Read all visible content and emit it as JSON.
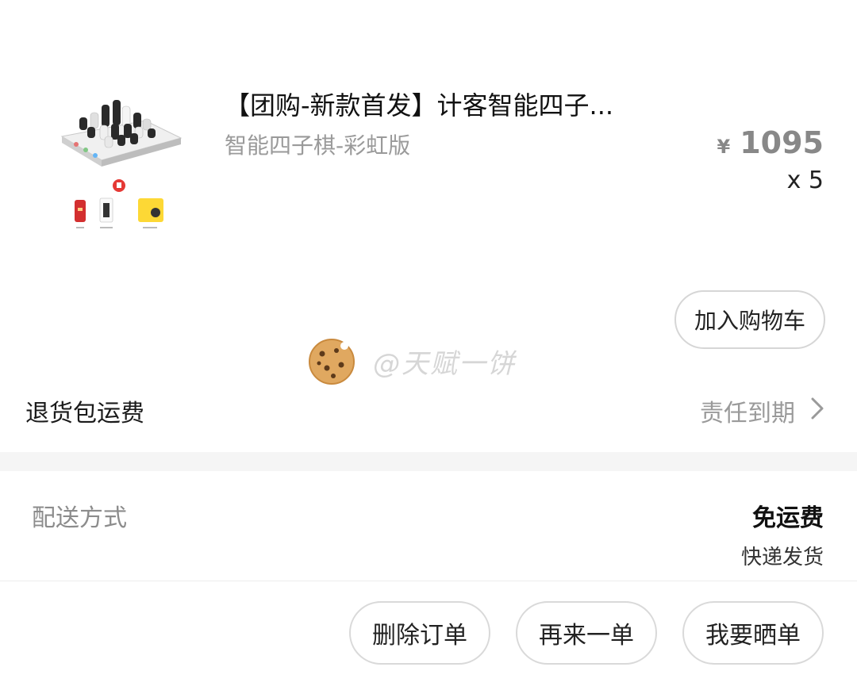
{
  "product": {
    "title": "【团购-新款首发】计客智能四子...",
    "variant": "智能四子棋-彩虹版",
    "price_symbol": "¥",
    "price": "1095",
    "quantity": "x 5",
    "add_to_cart_label": "加入购物车",
    "thumbnail_icon": "board-game-icon"
  },
  "watermark": {
    "text": "@天赋一饼",
    "icon": "cookie-icon"
  },
  "return_shipping": {
    "label": "退货包运费",
    "status": "责任到期",
    "icon": "chevron-right-icon"
  },
  "delivery": {
    "label": "配送方式",
    "fee": "免运费",
    "method": "快递发货"
  },
  "actions": {
    "delete_label": "删除订单",
    "reorder_label": "再来一单",
    "share_label": "我要晒单"
  }
}
